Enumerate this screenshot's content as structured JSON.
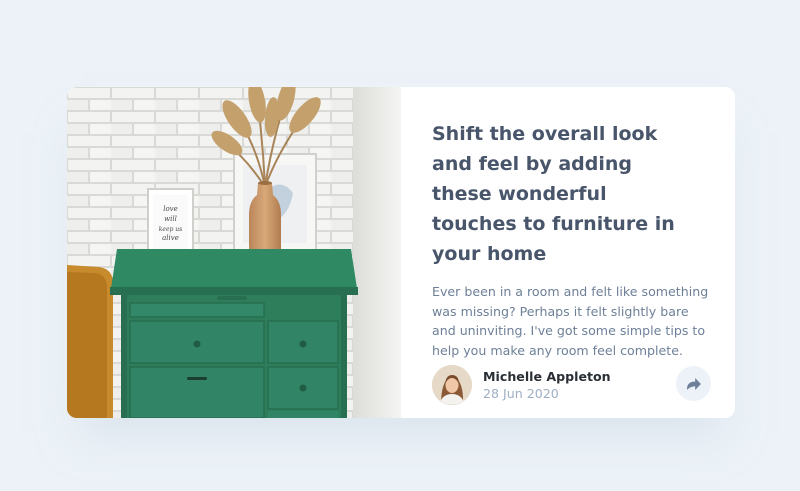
{
  "article": {
    "title": "Shift the overall look and feel by adding these wonderful touches to furniture in your home",
    "excerpt": "Ever been in a room and felt like something was missing? Perhaps it felt slightly bare and uninviting. I've got some simple tips to help you make any room feel complete.",
    "image_alt": "Green drawers with framed print and vase of dried grass against a white brick wall",
    "frame_text": [
      "love",
      "will",
      "keep us",
      "alive"
    ]
  },
  "author": {
    "name": "Michelle Appleton",
    "date": "28 Jun 2020",
    "avatar_icon": "avatar-photo"
  },
  "share": {
    "icon": "share-icon"
  },
  "colors": {
    "background": "#ecf2f8",
    "card": "#ffffff",
    "title": "#48556a",
    "body_text": "#6e8098",
    "author_name": "#2a2f36",
    "date": "#9eafc2",
    "share_button_bg": "#ecf2f8",
    "share_icon": "#6e8098",
    "drawers": "#2e7d5b"
  }
}
